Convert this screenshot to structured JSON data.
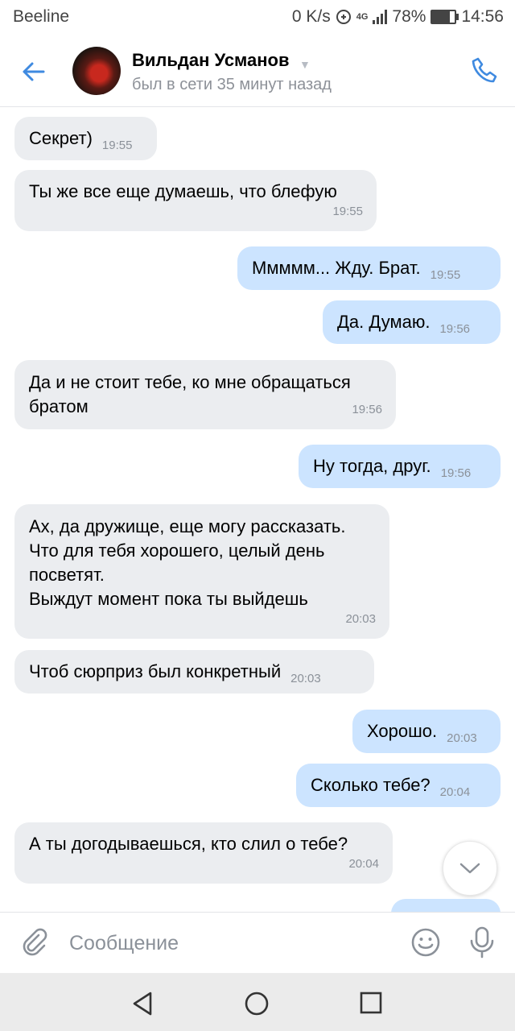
{
  "status_bar": {
    "carrier": "Beeline",
    "net_speed": "0 K/s",
    "network": "4G",
    "battery": "78%",
    "battery_level": 0.78,
    "time": "14:56"
  },
  "header": {
    "contact_name": "Вильдан Усманов",
    "last_seen": "был в сети 35 минут назад",
    "icons": {
      "back": "arrow-left-icon",
      "call": "phone-icon",
      "expand": "chevron-down-icon"
    }
  },
  "messages": [
    {
      "dir": "in",
      "text": "Секрет)",
      "time": "19:55"
    },
    {
      "dir": "in",
      "text": "Ты же все еще думаешь, что блефую",
      "time": "19:55"
    },
    {
      "dir": "out",
      "text": "Ммммм... Жду. Брат.",
      "time": "19:55"
    },
    {
      "dir": "out",
      "text": "Да. Думаю.",
      "time": "19:56"
    },
    {
      "dir": "in",
      "text": "Да и не стоит тебе, ко мне обращаться\nбратом",
      "time": "19:56"
    },
    {
      "dir": "out",
      "text": "Ну тогда, друг.",
      "time": "19:56"
    },
    {
      "dir": "in",
      "text": "Ах, да дружище, еще могу рассказать.\nЧто для тебя хорошего, целый день\nпосветят.\nВыждут момент пока ты выйдешь",
      "time": "20:03"
    },
    {
      "dir": "in",
      "text": "Чтоб сюрприз был конкретный",
      "time": "20:03"
    },
    {
      "dir": "out",
      "text": "Хорошо.",
      "time": "20:03"
    },
    {
      "dir": "out",
      "text": "Сколько тебе?",
      "time": "20:04"
    },
    {
      "dir": "in",
      "text": "А ты догодываешься, кто слил о тебе?",
      "time": "20:04"
    }
  ],
  "composer": {
    "placeholder": "Сообщение",
    "icons": {
      "attach": "paperclip-icon",
      "emoji": "emoji-icon",
      "voice": "microphone-icon"
    }
  },
  "scroll_down": {
    "icon": "chevron-down-icon"
  },
  "colors": {
    "accent": "#3f8ae0",
    "incoming_bubble": "#ebedf0",
    "outgoing_bubble": "#cce4ff",
    "time_text": "#8b9199"
  }
}
